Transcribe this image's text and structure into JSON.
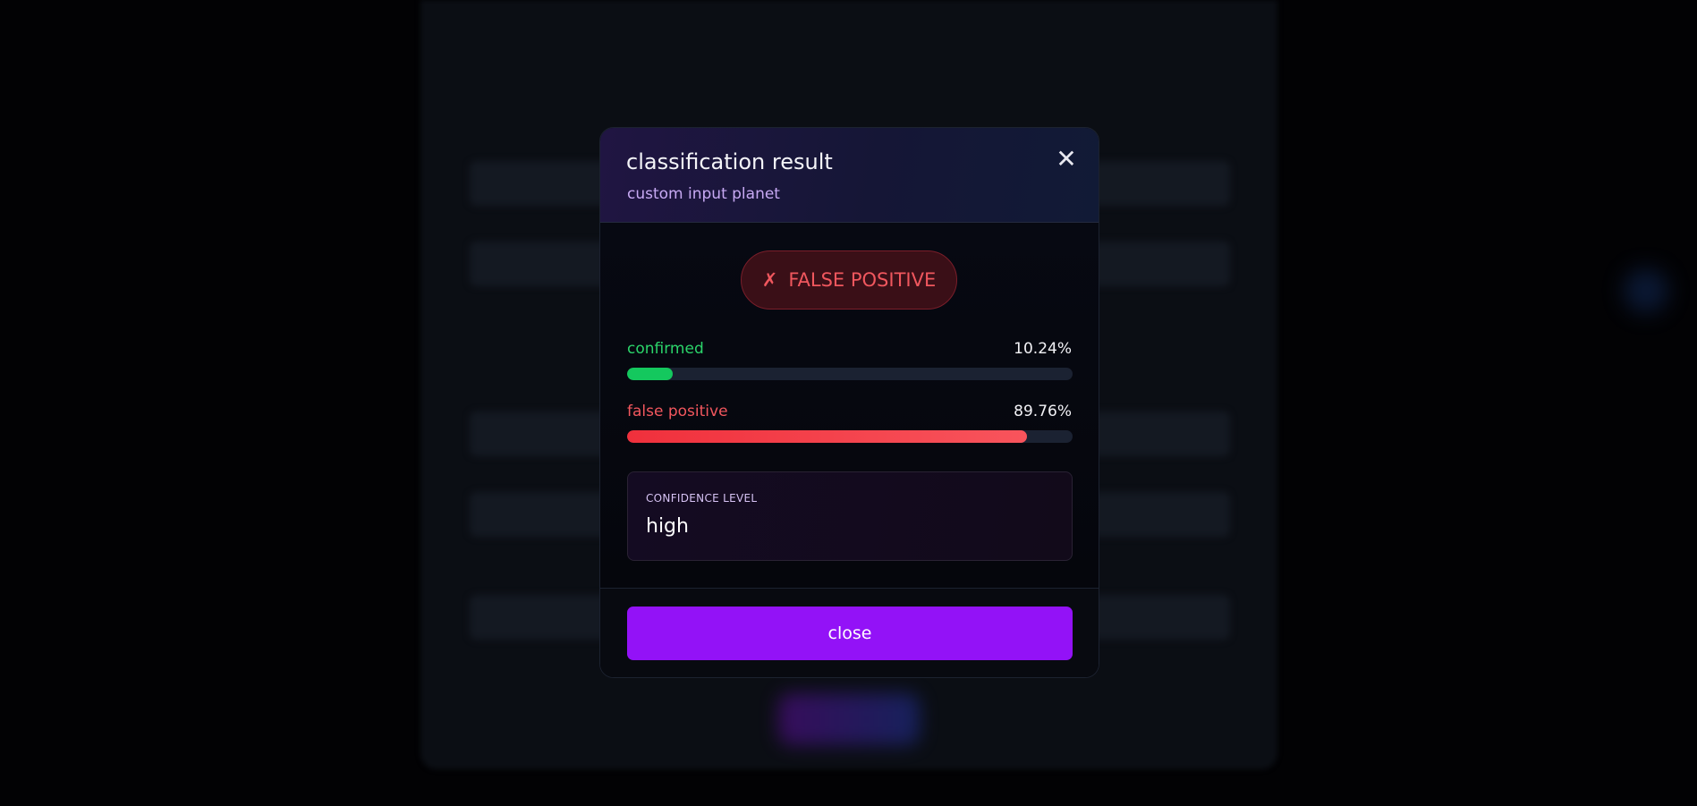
{
  "modal": {
    "title": "classification result",
    "subtitle": "custom input planet",
    "close_icon_glyph": "✕",
    "verdict": {
      "icon_glyph": "✗",
      "label": "FALSE POSITIVE",
      "color": "#f0575e"
    },
    "probabilities": [
      {
        "label": "confirmed",
        "value_text": "10.24%",
        "value": 10.24,
        "color": "#14c85e"
      },
      {
        "label": "false positive",
        "value_text": "89.76%",
        "value": 89.76,
        "color": "#f0404a"
      }
    ],
    "confidence": {
      "label": "CONFIDENCE LEVEL",
      "value": "high"
    },
    "close_button_label": "close",
    "accent_color": "#9312f7"
  }
}
